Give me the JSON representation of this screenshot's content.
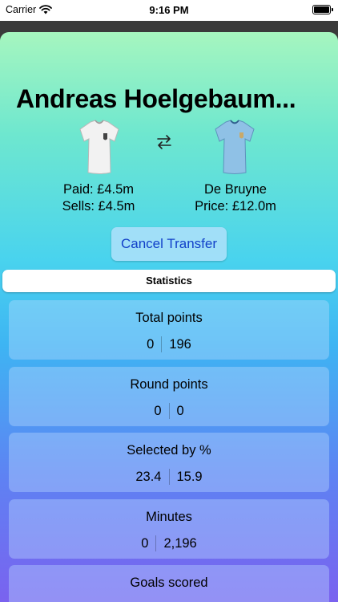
{
  "status_bar": {
    "carrier": "Carrier",
    "time": "9:16 PM"
  },
  "transfer": {
    "player_out": {
      "name": "Andreas Hoelgebaum...",
      "paid": "Paid: £4.5m",
      "sells": "Sells: £4.5m",
      "kit_color": "#f2f2f2"
    },
    "player_in": {
      "name": "De Bruyne",
      "price": "Price: £12.0m",
      "kit_color": "#8fc1e6"
    },
    "swap_icon": "arrow-swap-icon",
    "cancel_label": "Cancel Transfer"
  },
  "segment": {
    "label": "Statistics"
  },
  "stats": [
    {
      "title": "Total points",
      "out": "0",
      "in": "196"
    },
    {
      "title": "Round points",
      "out": "0",
      "in": "0"
    },
    {
      "title": "Selected by %",
      "out": "23.4",
      "in": "15.9"
    },
    {
      "title": "Minutes",
      "out": "0",
      "in": "2,196"
    },
    {
      "title": "Goals scored"
    }
  ],
  "colors": {
    "button_text": "#1241c9",
    "gradient_top": "#a6f6bf",
    "gradient_bottom": "#7a62ef"
  }
}
